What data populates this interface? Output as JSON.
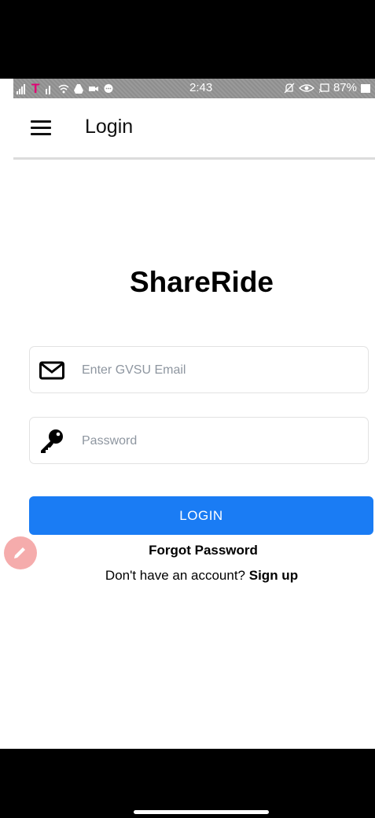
{
  "status_bar": {
    "carrier": "T",
    "time": "2:43",
    "battery": "87%"
  },
  "app_bar": {
    "title": "Login"
  },
  "brand": {
    "name": "ShareRide"
  },
  "form": {
    "email_placeholder": "Enter GVSU Email",
    "password_placeholder": "Password",
    "login_label": "LOGIN",
    "forgot_label": "Forgot Password",
    "no_account_text": "Don't have an account? ",
    "signup_label": "Sign up"
  },
  "colors": {
    "primary": "#1a7cf4",
    "fab": "#f4a4a4"
  }
}
